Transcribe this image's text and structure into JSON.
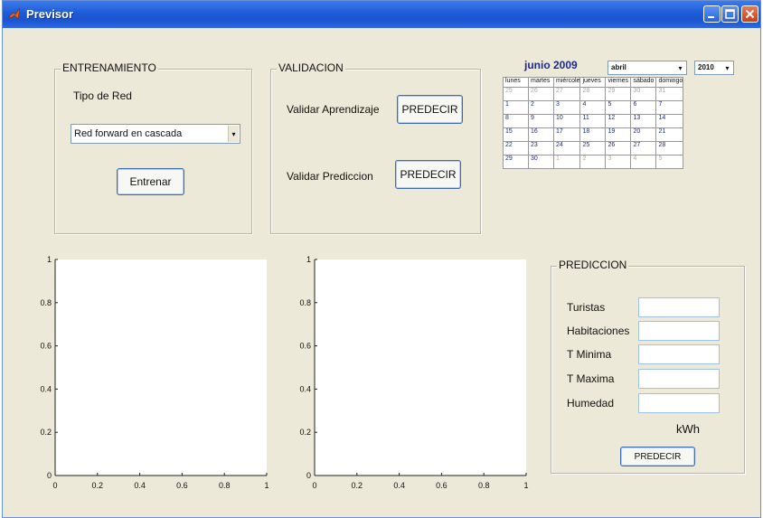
{
  "window": {
    "title": "Previsor",
    "colors": {
      "titlebar": "#245edb",
      "client": "#ece9d8",
      "calendar_text": "#1c2a8e"
    }
  },
  "entrenamiento": {
    "title": "ENTRENAMIENTO",
    "tipo_label": "Tipo de Red",
    "tipo_value": "Red forward en cascada",
    "button": "Entrenar"
  },
  "validacion": {
    "title": "VALIDACION",
    "aprendizaje_label": "Validar Aprendizaje",
    "aprendizaje_button": "PREDECIR",
    "prediccion_label": "Validar Prediccion",
    "prediccion_button": "PREDECIR"
  },
  "calendar": {
    "header": "junio 2009",
    "month_select": "abril",
    "year_select": "2010",
    "days": [
      "lunes",
      "martes",
      "miércole",
      "jueves",
      "viernes",
      "sábado",
      "domingo"
    ],
    "weeks": [
      [
        {
          "d": "25",
          "o": true
        },
        {
          "d": "26",
          "o": true
        },
        {
          "d": "27",
          "o": true
        },
        {
          "d": "28",
          "o": true
        },
        {
          "d": "29",
          "o": true
        },
        {
          "d": "30",
          "o": true
        },
        {
          "d": "31",
          "o": true
        }
      ],
      [
        {
          "d": "1"
        },
        {
          "d": "2"
        },
        {
          "d": "3"
        },
        {
          "d": "4"
        },
        {
          "d": "5"
        },
        {
          "d": "6"
        },
        {
          "d": "7"
        }
      ],
      [
        {
          "d": "8"
        },
        {
          "d": "9"
        },
        {
          "d": "10"
        },
        {
          "d": "11"
        },
        {
          "d": "12"
        },
        {
          "d": "13"
        },
        {
          "d": "14"
        }
      ],
      [
        {
          "d": "15"
        },
        {
          "d": "16"
        },
        {
          "d": "17"
        },
        {
          "d": "18"
        },
        {
          "d": "19"
        },
        {
          "d": "20"
        },
        {
          "d": "21"
        }
      ],
      [
        {
          "d": "22"
        },
        {
          "d": "23"
        },
        {
          "d": "24"
        },
        {
          "d": "25"
        },
        {
          "d": "26"
        },
        {
          "d": "27"
        },
        {
          "d": "28"
        }
      ],
      [
        {
          "d": "29"
        },
        {
          "d": "30"
        },
        {
          "d": "1",
          "o": true
        },
        {
          "d": "2",
          "o": true
        },
        {
          "d": "3",
          "o": true
        },
        {
          "d": "4",
          "o": true
        },
        {
          "d": "5",
          "o": true
        }
      ]
    ]
  },
  "plots": [
    {
      "y_ticks": [
        "0",
        "0.2",
        "0.4",
        "0.6",
        "0.8",
        "1"
      ],
      "x_ticks": [
        "0",
        "0.2",
        "0.4",
        "0.6",
        "0.8",
        "1"
      ]
    },
    {
      "y_ticks": [
        "0",
        "0.2",
        "0.4",
        "0.6",
        "0.8",
        "1"
      ],
      "x_ticks": [
        "0",
        "0.2",
        "0.4",
        "0.6",
        "0.8",
        "1"
      ]
    }
  ],
  "prediccion": {
    "title": "PREDICCION",
    "fields": [
      "Turistas",
      "Habitaciones",
      "T Minima",
      "T Maxima",
      "Humedad"
    ],
    "unit": "kWh",
    "button": "PREDECIR"
  }
}
